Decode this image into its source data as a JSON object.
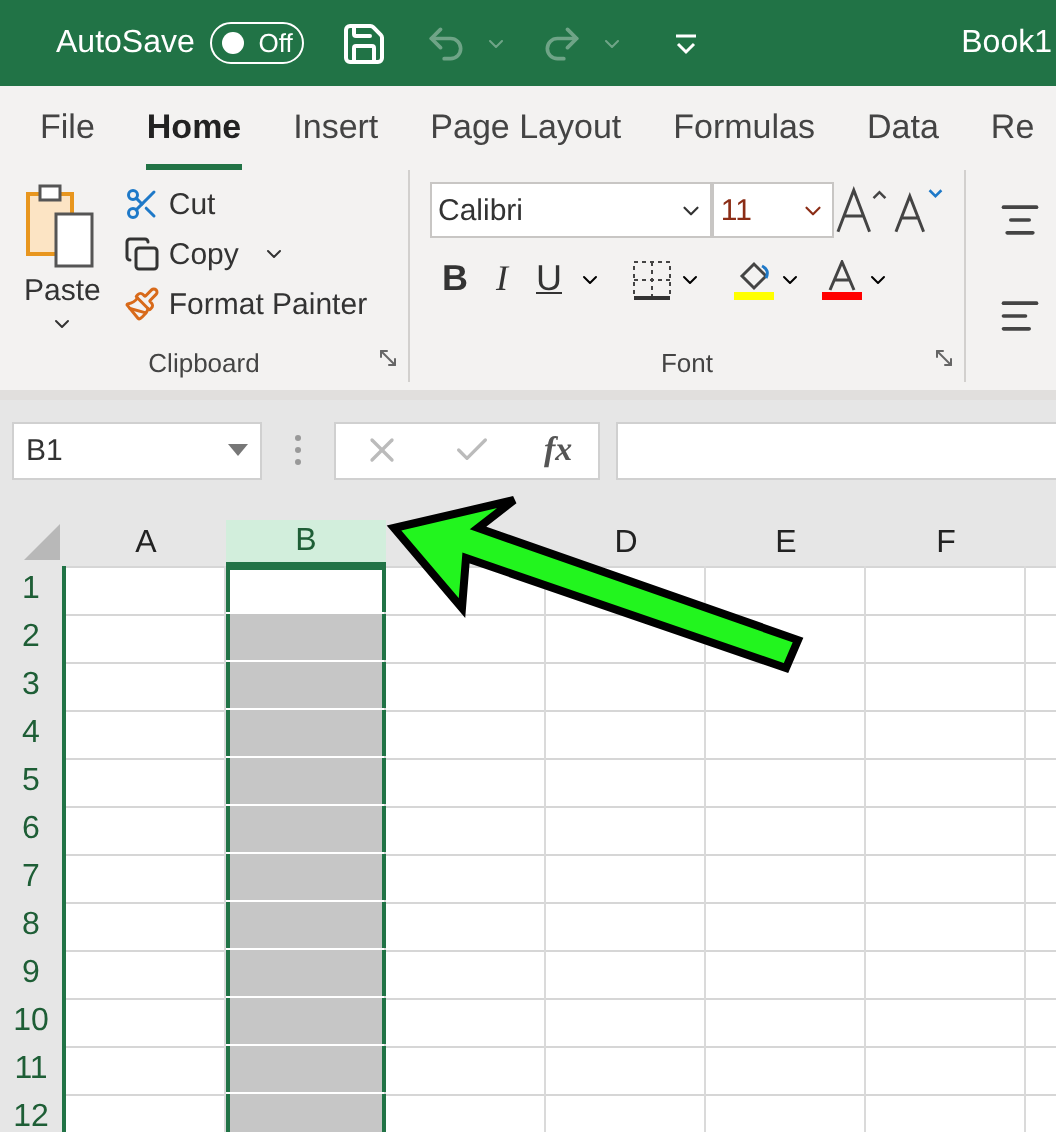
{
  "title_bar": {
    "autosave_label": "AutoSave",
    "autosave": {
      "on": false,
      "label": "Off"
    },
    "undo_disabled": true,
    "redo_disabled": true,
    "document_title": "Book1"
  },
  "tabs": [
    {
      "label": "File",
      "selected": false
    },
    {
      "label": "Home",
      "selected": true
    },
    {
      "label": "Insert",
      "selected": false
    },
    {
      "label": "Page Layout",
      "selected": false
    },
    {
      "label": "Formulas",
      "selected": false
    },
    {
      "label": "Data",
      "selected": false
    },
    {
      "label": "Re",
      "selected": false
    }
  ],
  "clipboard_group": {
    "paste": "Paste",
    "cut": "Cut",
    "copy": "Copy",
    "format_painter": "Format Painter",
    "label": "Clipboard"
  },
  "font_group": {
    "font_name": "Calibri",
    "font_size": "11",
    "bold": "B",
    "italic": "I",
    "underline": "U",
    "label": "Font"
  },
  "formula_bar": {
    "name_box": "B1",
    "cancel_disabled": true,
    "enter_disabled": true,
    "function": "fx"
  },
  "sheet": {
    "columns": [
      {
        "label": "A",
        "selected": false
      },
      {
        "label": "B",
        "selected": true
      },
      {
        "selected": false
      },
      {
        "label": "D",
        "selected": false
      },
      {
        "label": "E",
        "selected": false
      },
      {
        "label": "F",
        "selected": false
      }
    ],
    "rows": [
      {
        "label": "1",
        "active": true
      },
      {
        "label": "2",
        "active": false
      },
      {
        "label": "3",
        "active": false
      },
      {
        "label": "4",
        "active": false
      },
      {
        "label": "5",
        "active": false
      },
      {
        "label": "6",
        "active": false
      },
      {
        "label": "7",
        "active": false
      },
      {
        "label": "8",
        "active": false
      },
      {
        "label": "9",
        "active": false
      },
      {
        "label": "10",
        "active": false
      },
      {
        "label": "11",
        "active": false
      },
      {
        "label": "12",
        "active": false
      }
    ]
  }
}
